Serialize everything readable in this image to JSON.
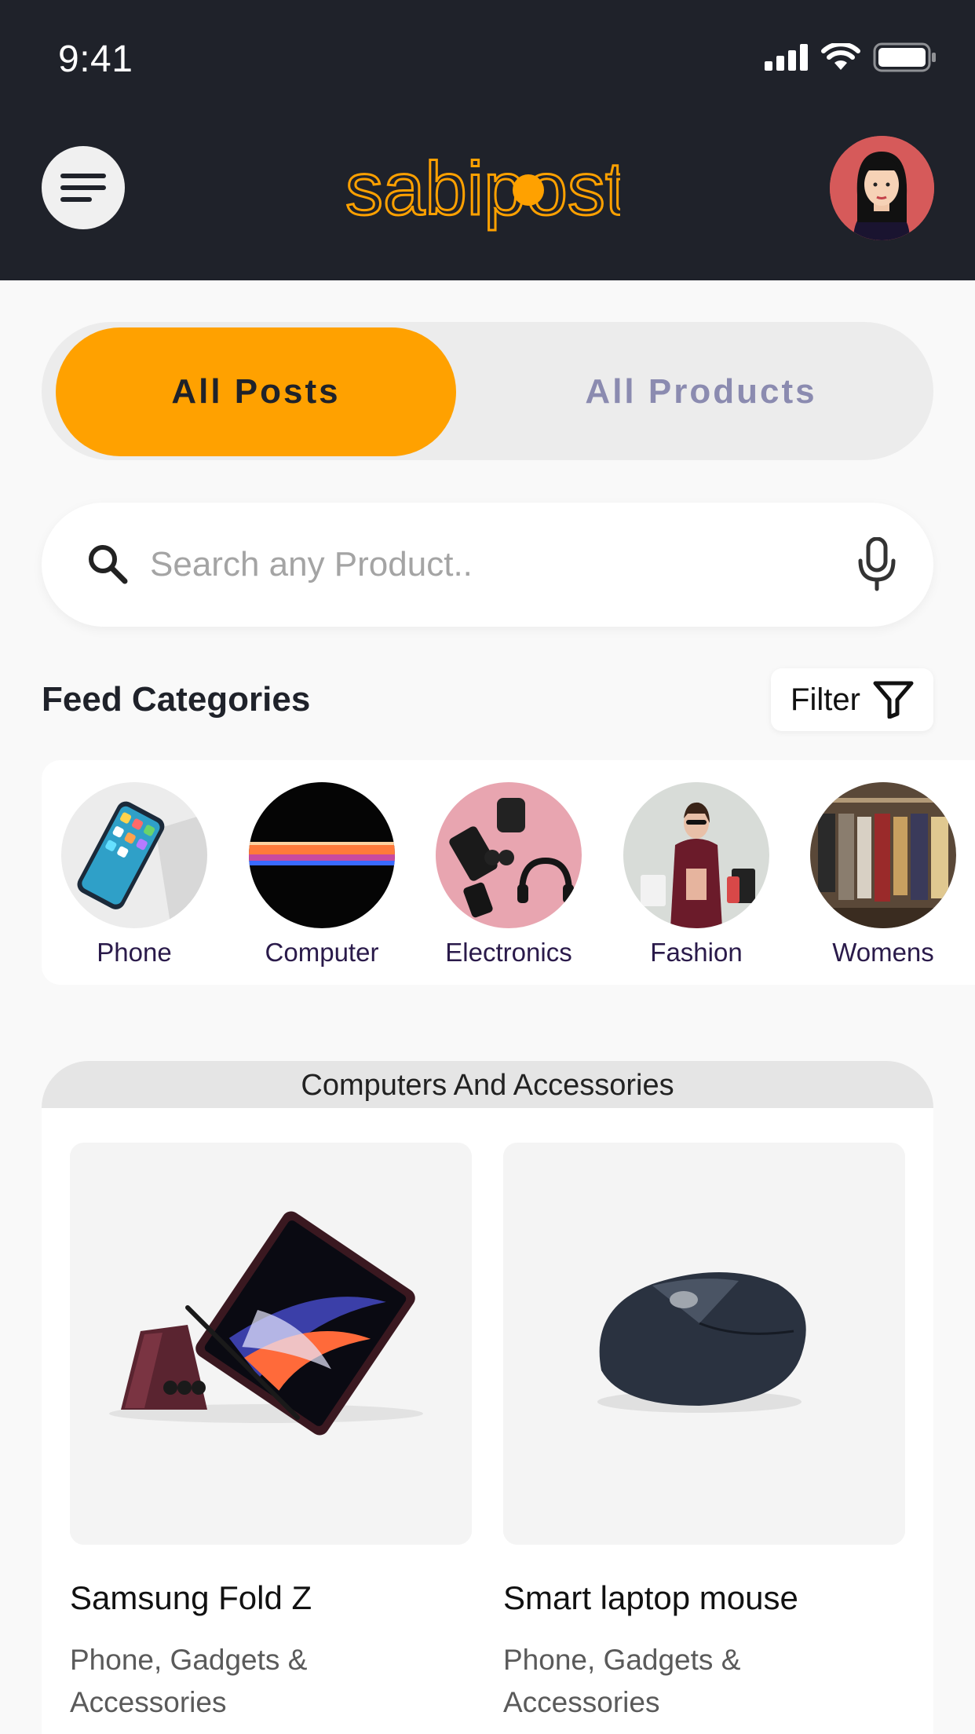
{
  "status_bar": {
    "time": "9:41"
  },
  "header": {
    "logo_text": "sabipost",
    "accent_color": "#ffa100",
    "bg_color": "#1f222a"
  },
  "tabs": [
    {
      "label": "All Posts",
      "active": true
    },
    {
      "label": "All Products",
      "active": false
    }
  ],
  "search": {
    "placeholder": "Search any Product.."
  },
  "feed": {
    "title": "Feed Categories",
    "filter_label": "Filter",
    "categories": [
      {
        "label": "Phone"
      },
      {
        "label": "Computer"
      },
      {
        "label": "Electronics"
      },
      {
        "label": "Fashion"
      },
      {
        "label": "Womens"
      }
    ]
  },
  "group": {
    "title": "Computers And Accessories",
    "products": [
      {
        "name": "Samsung Fold Z",
        "category": "Phone, Gadgets & Accessories"
      },
      {
        "name": "Smart laptop mouse",
        "category": "Phone, Gadgets & Accessories"
      }
    ]
  }
}
